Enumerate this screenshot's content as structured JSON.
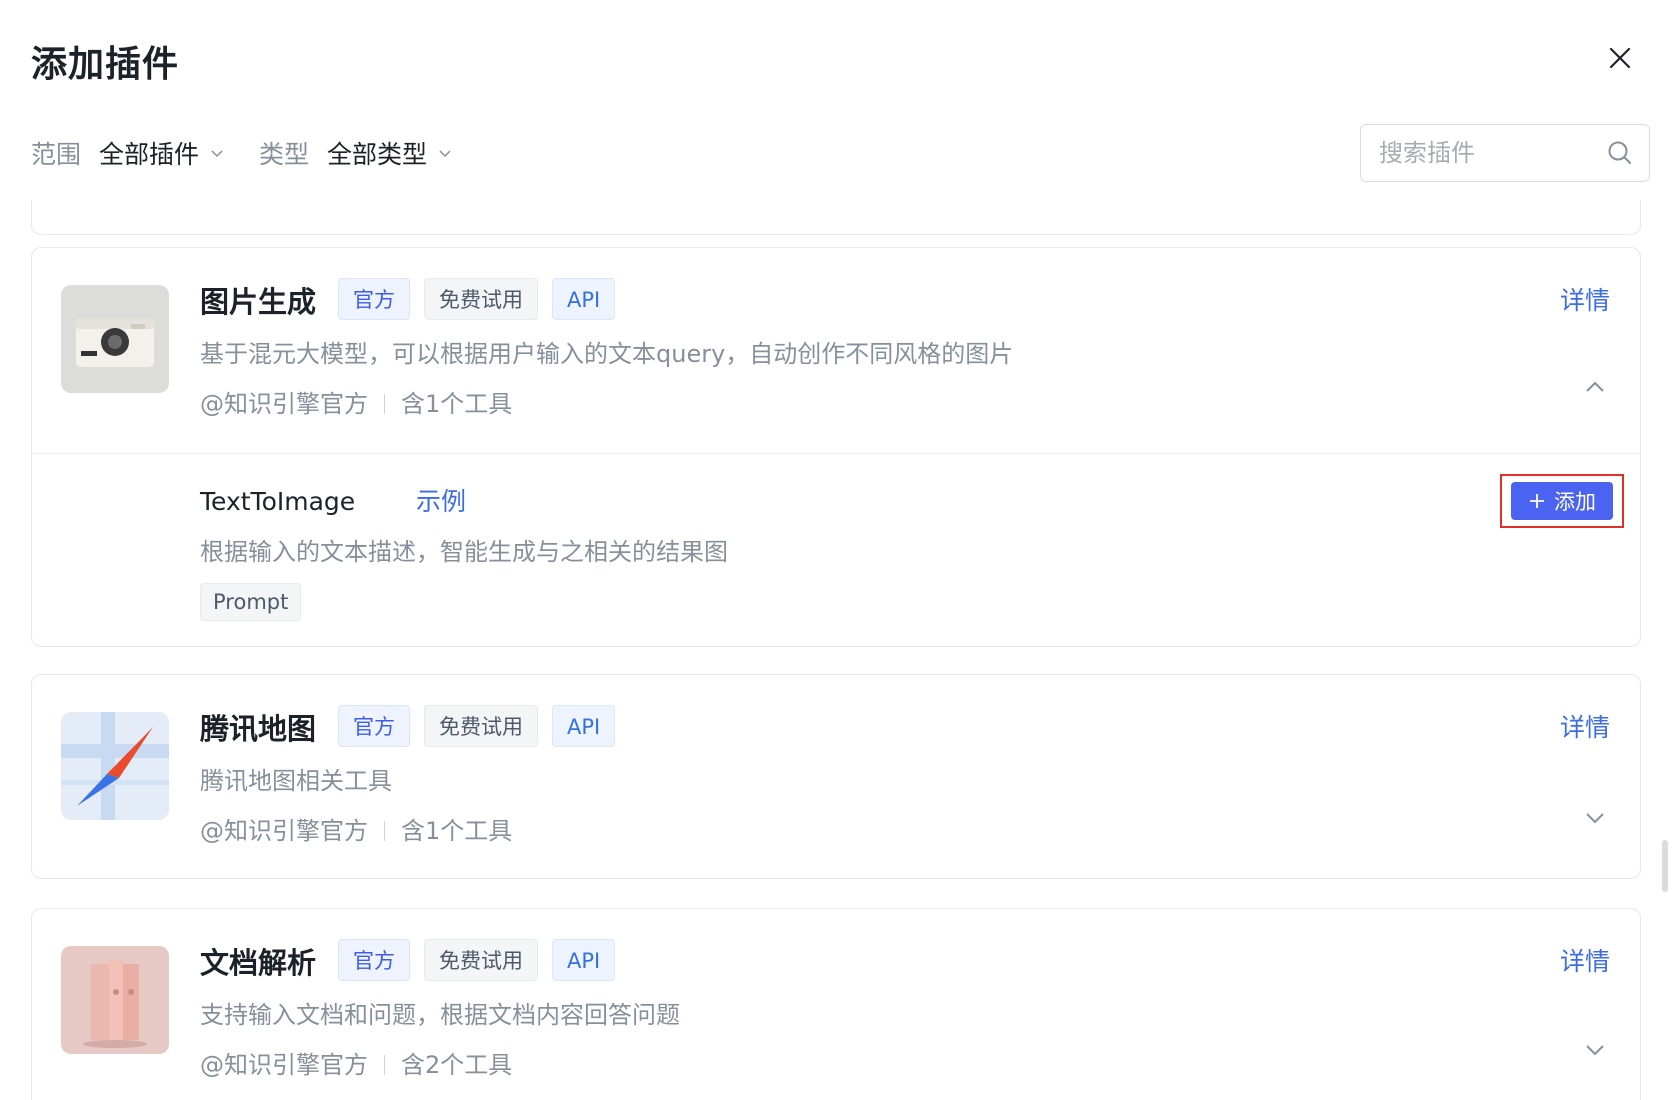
{
  "modal": {
    "title": "添加插件"
  },
  "filters": {
    "scope_label": "范围",
    "scope_value": "全部插件",
    "type_label": "类型",
    "type_value": "全部类型"
  },
  "search": {
    "placeholder": "搜索插件",
    "value": ""
  },
  "plugins": [
    {
      "name": "图片生成",
      "tags": [
        "官方",
        "免费试用",
        "API"
      ],
      "description": "基于混元大模型，可以根据用户输入的文本query，自动创作不同风格的图片",
      "author": "@知识引擎官方",
      "tool_count": "含1个工具",
      "detail_label": "详情",
      "expanded": true,
      "icon": "camera-icon",
      "tools": [
        {
          "name": "TextToImage",
          "example_label": "示例",
          "description": "根据输入的文本描述，智能生成与之相关的结果图",
          "params": [
            "Prompt"
          ],
          "add_label": "添加"
        }
      ]
    },
    {
      "name": "腾讯地图",
      "tags": [
        "官方",
        "免费试用",
        "API"
      ],
      "description": "腾讯地图相关工具",
      "author": "@知识引擎官方",
      "tool_count": "含1个工具",
      "detail_label": "详情",
      "expanded": false,
      "icon": "map-compass-icon"
    },
    {
      "name": "文档解析",
      "tags": [
        "官方",
        "免费试用",
        "API"
      ],
      "description": "支持输入文档和问题，根据文档内容回答问题",
      "author": "@知识引擎官方",
      "tool_count": "含2个工具",
      "detail_label": "详情",
      "expanded": false,
      "icon": "document-books-icon"
    }
  ],
  "colors": {
    "accent": "#3a6de6",
    "primary_button": "#4a63f0",
    "highlight_outline": "#e0302a",
    "muted_text": "#86909c"
  }
}
